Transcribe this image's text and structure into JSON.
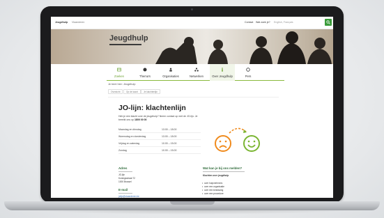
{
  "topbar": {
    "logo": "Jeugdhulp",
    "subtitle": "Vlaanderen",
    "links": [
      "Contact",
      "Wat zoek je?",
      "English, Français"
    ]
  },
  "hero": {
    "title": "Jeugdhulp"
  },
  "nav": {
    "items": [
      {
        "label": "Zoeken",
        "icon": "search-icon",
        "active": true
      },
      {
        "label": "Thema's",
        "icon": "globe-icon",
        "active": false
      },
      {
        "label": "Organisaties",
        "icon": "people-icon",
        "active": false
      },
      {
        "label": "Netwerken",
        "icon": "network-icon",
        "active": false
      },
      {
        "label": "Over Jeugdhulp",
        "icon": "info-icon",
        "active": false,
        "selected": true
      },
      {
        "label": "Pers",
        "icon": "megaphone-icon",
        "active": false
      }
    ]
  },
  "breadcrumb": "Je bent hier: Jeugdhulp",
  "toolbar": {
    "items": [
      "Overzicht",
      "Op de kaart",
      "Je klachtenlijn"
    ]
  },
  "page": {
    "title": "JO-lijn: klachtenlijn",
    "intro_text": "Heb je een klacht over de jeugdhulp? Neem contact op met de JO-lijn. Je bereikt ons op",
    "intro_phone": "1800 00 00"
  },
  "hours": [
    {
      "day": "Maandag en dinsdag",
      "time": "13.00 – 18.00"
    },
    {
      "day": "Woensdag en donderdag",
      "time": "13.00 – 18.00"
    },
    {
      "day": "Vrijdag en zaterdag",
      "time": "10.00 – 15.00"
    },
    {
      "day": "Zondag",
      "time": "10.00 – 15.00"
    }
  ],
  "left_col": {
    "heading": "Adres",
    "name": "JO-lijn",
    "street": "Koningsstraat 72",
    "city": "1000 Brussel",
    "email_heading": "E-mail",
    "email": "jolijn@vlaanderen.be"
  },
  "right_col": {
    "heading": "Wat kan je bij ons melden?",
    "subheading": "Klachten over jeugdhulp",
    "items": [
      "over hulpverleners",
      "over een organisatie",
      "over een beslissing",
      "over een procedure"
    ]
  },
  "colors": {
    "accent_green": "#6aa12f",
    "sad_face": "#f08a1c",
    "happy_face": "#7ab531"
  }
}
